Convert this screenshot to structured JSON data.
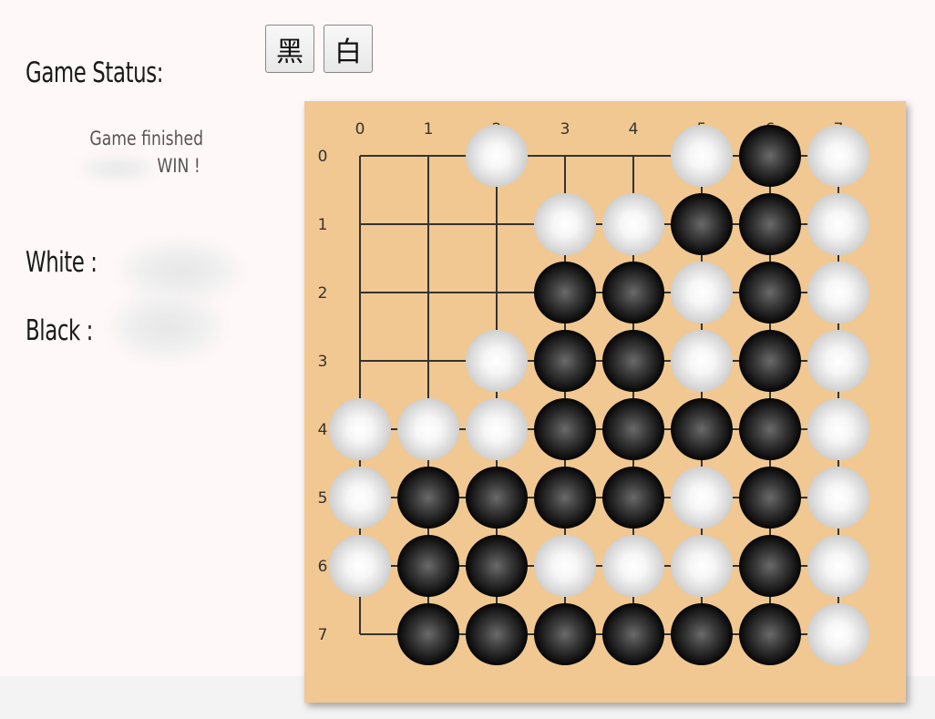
{
  "buttons": {
    "black_label": "黑",
    "white_label": "白"
  },
  "status": {
    "heading": "Game Status:",
    "line1": "Game finished",
    "line2": "WIN !"
  },
  "players": {
    "white_label": "White :",
    "black_label": "Black :"
  },
  "board": {
    "size": 8,
    "col_labels": [
      "0",
      "1",
      "2",
      "3",
      "4",
      "5",
      "6",
      "7"
    ],
    "row_labels": [
      "0",
      "1",
      "2",
      "3",
      "4",
      "5",
      "6",
      "7"
    ],
    "cells": [
      "..W..WBW",
      "...WWBBW",
      "...BBWBW",
      "..WBBWBW",
      "WWWBBBBW",
      "WBBBBWBW",
      "WBBWWWBW",
      ".BBBBBBW"
    ],
    "colors": {
      "background": "#f1c891",
      "line": "#333333",
      "black_stone": "#111111",
      "white_stone": "#d8d8d8"
    }
  }
}
